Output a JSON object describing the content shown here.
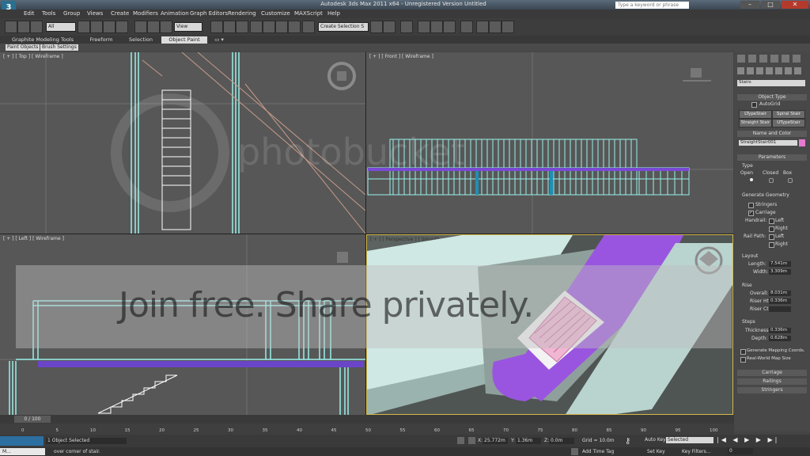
{
  "window": {
    "title": "Autodesk 3ds Max 2011 x64 - Unregistered Version  Untitled",
    "search_placeholder": "Type a keyword or phrase",
    "logo_text": "3"
  },
  "menu": [
    "Edit",
    "Tools",
    "Group",
    "Views",
    "Create",
    "Modifiers",
    "Animation",
    "Graph Editors",
    "Rendering",
    "Customize",
    "MAXScript",
    "Help"
  ],
  "toolbar": {
    "selection_filter": "All",
    "ref_coord": "View",
    "named_selection": "Create Selection S"
  },
  "ribbon": {
    "tabs": [
      "Graphite Modeling Tools",
      "Freeform",
      "Selection",
      "Object Paint"
    ],
    "active_tab": "Object Paint",
    "subtabs": [
      "Paint Objects",
      "Brush Settings"
    ]
  },
  "viewports": {
    "top": "[ + ] [ Top ] [ Wireframe ]",
    "front": "[ + ] [ Front ] [ Wireframe ]",
    "left": "[ + ] [ Left ] [ Wireframe ]",
    "perspective": "[ + ] [ Perspective ] [ Smooth + Highlights ]"
  },
  "command_panel": {
    "category": "Stairs",
    "object_type_title": "Object Type",
    "autogrid": "AutoGrid",
    "stair_buttons": [
      "LTypeStair",
      "Spiral Stair",
      "Straight Stair",
      "UTypeStair"
    ],
    "name_color_title": "Name and Color",
    "object_name": "StraightStair001",
    "object_color": "#e67ad0",
    "parameters_title": "Parameters",
    "type_label": "Type",
    "type_options": [
      "Open",
      "Closed",
      "Box"
    ],
    "generate_geometry": "Generate Geometry",
    "stringers": "Stringers",
    "carriage": "Carriage",
    "handrail_label": "Handrail:",
    "rail_path_label": "Rail Path:",
    "left": "Left",
    "right": "Right",
    "layout_label": "Layout",
    "length_label": "Length:",
    "length_value": "7.541m",
    "width_label": "Width:",
    "width_value": "3.309m",
    "rise_label": "Rise",
    "overall_label": "Overall:",
    "overall_value": "8.031m",
    "riser_ht_label": "Riser Ht:",
    "riser_ht_value": "0.336m",
    "riser_ct_label": "Riser Ct:",
    "riser_ct_value": "",
    "steps_label": "Steps",
    "thickness_label": "Thickness:",
    "thickness_value": "0.336m",
    "depth_label": "Depth:",
    "depth_value": "0.628m",
    "gen_mapping": "Generate Mapping Coords.",
    "real_world": "Real-World Map Size",
    "rollouts": [
      "Carriage",
      "Railings",
      "Stringers"
    ]
  },
  "timeline": {
    "frame_counter": "0 / 100",
    "ticks": [
      "0",
      "5",
      "10",
      "15",
      "20",
      "25",
      "30",
      "35",
      "40",
      "45",
      "50",
      "55",
      "60",
      "65",
      "70",
      "75",
      "80",
      "85",
      "90",
      "95",
      "100"
    ]
  },
  "status": {
    "selection": "1 Object Selected",
    "prompt": "over corner of stair.",
    "x_label": "X:",
    "x_value": "25.772m",
    "y_label": "Y:",
    "y_value": "1.36m",
    "z_label": "Z:",
    "z_value": "0.0m",
    "grid": "Grid = 10.0m",
    "add_time_tag": "Add Time Tag",
    "auto_key": "Auto Key",
    "set_key": "Set Key",
    "selected_dropdown": "Selected",
    "key_filters": "Key Filters...",
    "frame": "0",
    "taskbar_item": "M..."
  },
  "watermark": {
    "logo": "photobucket",
    "banner": "Join free. Share privately."
  }
}
